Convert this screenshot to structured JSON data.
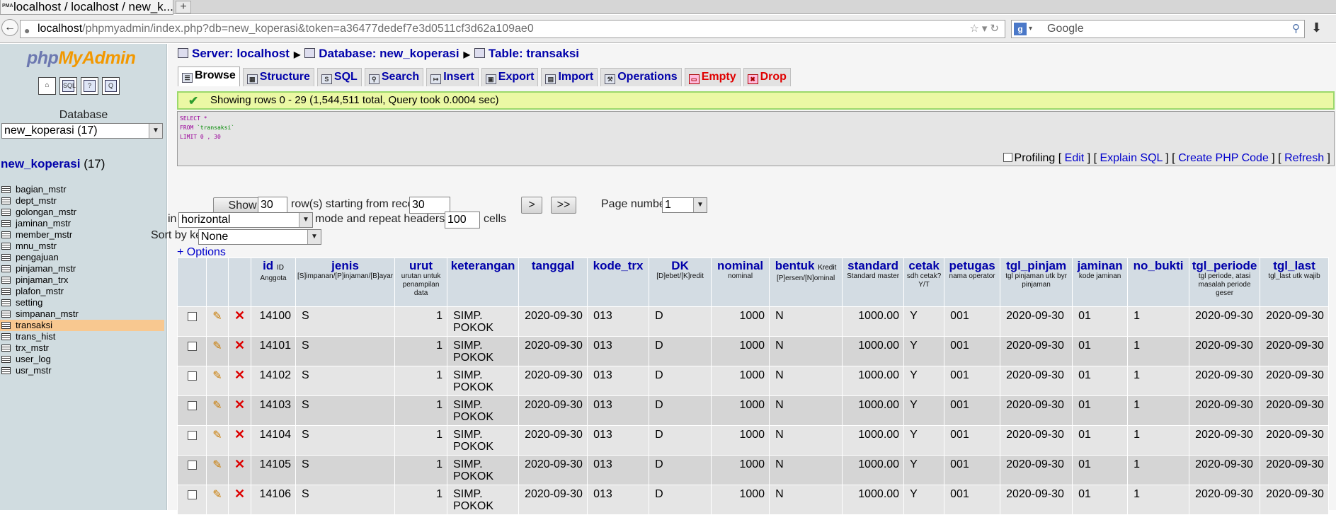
{
  "browser": {
    "tab_title": "localhost / localhost / new_k...",
    "tab_favicon": "PMA",
    "new_tab": "+",
    "url_host": "localhost",
    "url_rest": "/phpmyadmin/index.php?db=new_koperasi&token=a36477dedef7e3d0511cf3d62a109ae0",
    "search_placeholder": "Google"
  },
  "left": {
    "logo_php": "php",
    "logo_my": "My",
    "logo_admin": "Admin",
    "icons": [
      "home-icon",
      "sql-query-icon",
      "docs-icon",
      "query-window-icon"
    ],
    "database_label": "Database",
    "database_select": "new_koperasi (17)",
    "db_name": "new_koperasi",
    "db_count": "(17)",
    "tables": [
      "bagian_mstr",
      "dept_mstr",
      "golongan_mstr",
      "jaminan_mstr",
      "member_mstr",
      "mnu_mstr",
      "pengajuan",
      "pinjaman_mstr",
      "pinjaman_trx",
      "plafon_mstr",
      "setting",
      "simpanan_mstr",
      "transaksi",
      "trans_hist",
      "trx_mstr",
      "user_log",
      "usr_mstr"
    ],
    "active_table": "transaksi"
  },
  "breadcrumb": {
    "server": "Server: localhost",
    "database": "Database: new_koperasi",
    "table": "Table: transaksi"
  },
  "tabs": [
    {
      "label": "Browse",
      "icon": "browse-icon"
    },
    {
      "label": "Structure",
      "icon": "structure-icon"
    },
    {
      "label": "SQL",
      "icon": "sql-icon"
    },
    {
      "label": "Search",
      "icon": "search-icon"
    },
    {
      "label": "Insert",
      "icon": "insert-icon"
    },
    {
      "label": "Export",
      "icon": "export-icon"
    },
    {
      "label": "Import",
      "icon": "import-icon"
    },
    {
      "label": "Operations",
      "icon": "operations-icon"
    },
    {
      "label": "Empty",
      "icon": "empty-icon"
    },
    {
      "label": "Drop",
      "icon": "drop-icon"
    }
  ],
  "message": "Showing rows 0 - 29 (1,544,511 total, Query took 0.0004 sec)",
  "sql": {
    "line1": "SELECT *",
    "line2_kw": "FROM",
    "line2_tbl": "`transaksi`",
    "line3": "LIMIT 0 , 30"
  },
  "sql_links": {
    "profiling": "Profiling",
    "edit": "Edit",
    "explain": "Explain SQL",
    "php": "Create PHP Code",
    "refresh": "Refresh"
  },
  "nav": {
    "show_button": "Show :",
    "rows_value": "30",
    "rows_label": "row(s) starting from record #",
    "start_value": "30",
    "next_button": ">",
    "last_button": ">>",
    "page_label": "Page number:",
    "page_value": "1",
    "in_label": "in",
    "mode_value": "horizontal",
    "mode_label": "mode and repeat headers after",
    "repeat_value": "100",
    "cells_label": "cells",
    "sort_label": "Sort by key:",
    "sort_value": "None",
    "options_link": "+ Options"
  },
  "columns": [
    {
      "name": "id",
      "sub": "ID",
      "comment": "Anggota"
    },
    {
      "name": "jenis",
      "sub": "",
      "comment": "[S]impanan/[P]injaman/[B]ayar"
    },
    {
      "name": "urut",
      "sub": "",
      "comment": "urutan untuk penampilan data"
    },
    {
      "name": "keterangan",
      "sub": "",
      "comment": ""
    },
    {
      "name": "tanggal",
      "sub": "",
      "comment": ""
    },
    {
      "name": "kode_trx",
      "sub": "",
      "comment": ""
    },
    {
      "name": "DK",
      "sub": "",
      "comment": "[D]ebet/[K]redit"
    },
    {
      "name": "nominal",
      "sub": "",
      "comment": "nominal"
    },
    {
      "name": "bentuk",
      "sub": "Kredit",
      "comment": "[P]ersen/[N]ominal"
    },
    {
      "name": "standard",
      "sub": "",
      "comment": "Standard master"
    },
    {
      "name": "cetak",
      "sub": "",
      "comment": "sdh cetak? Y/T"
    },
    {
      "name": "petugas",
      "sub": "",
      "comment": "nama operator"
    },
    {
      "name": "tgl_pinjam",
      "sub": "",
      "comment": "tgl pinjaman utk byr pinjaman"
    },
    {
      "name": "jaminan",
      "sub": "",
      "comment": "kode jaminan"
    },
    {
      "name": "no_bukti",
      "sub": "",
      "comment": ""
    },
    {
      "name": "tgl_periode",
      "sub": "",
      "comment": "tgl periode, atasi masalah periode geser"
    },
    {
      "name": "tgl_last",
      "sub": "",
      "comment": "tgl_last utk wajib"
    }
  ],
  "rows": [
    [
      "14100",
      "S",
      "1",
      "SIMP. POKOK",
      "2020-09-30",
      "013",
      "D",
      "1000",
      "N",
      "1000.00",
      "Y",
      "001",
      "2020-09-30",
      "01",
      "1",
      "2020-09-30",
      "2020-09-30"
    ],
    [
      "14101",
      "S",
      "1",
      "SIMP. POKOK",
      "2020-09-30",
      "013",
      "D",
      "1000",
      "N",
      "1000.00",
      "Y",
      "001",
      "2020-09-30",
      "01",
      "1",
      "2020-09-30",
      "2020-09-30"
    ],
    [
      "14102",
      "S",
      "1",
      "SIMP. POKOK",
      "2020-09-30",
      "013",
      "D",
      "1000",
      "N",
      "1000.00",
      "Y",
      "001",
      "2020-09-30",
      "01",
      "1",
      "2020-09-30",
      "2020-09-30"
    ],
    [
      "14103",
      "S",
      "1",
      "SIMP. POKOK",
      "2020-09-30",
      "013",
      "D",
      "1000",
      "N",
      "1000.00",
      "Y",
      "001",
      "2020-09-30",
      "01",
      "1",
      "2020-09-30",
      "2020-09-30"
    ],
    [
      "14104",
      "S",
      "1",
      "SIMP. POKOK",
      "2020-09-30",
      "013",
      "D",
      "1000",
      "N",
      "1000.00",
      "Y",
      "001",
      "2020-09-30",
      "01",
      "1",
      "2020-09-30",
      "2020-09-30"
    ],
    [
      "14105",
      "S",
      "1",
      "SIMP. POKOK",
      "2020-09-30",
      "013",
      "D",
      "1000",
      "N",
      "1000.00",
      "Y",
      "001",
      "2020-09-30",
      "01",
      "1",
      "2020-09-30",
      "2020-09-30"
    ],
    [
      "14106",
      "S",
      "1",
      "SIMP. POKOK",
      "2020-09-30",
      "013",
      "D",
      "1000",
      "N",
      "1000.00",
      "Y",
      "001",
      "2020-09-30",
      "01",
      "1",
      "2020-09-30",
      "2020-09-30"
    ]
  ]
}
